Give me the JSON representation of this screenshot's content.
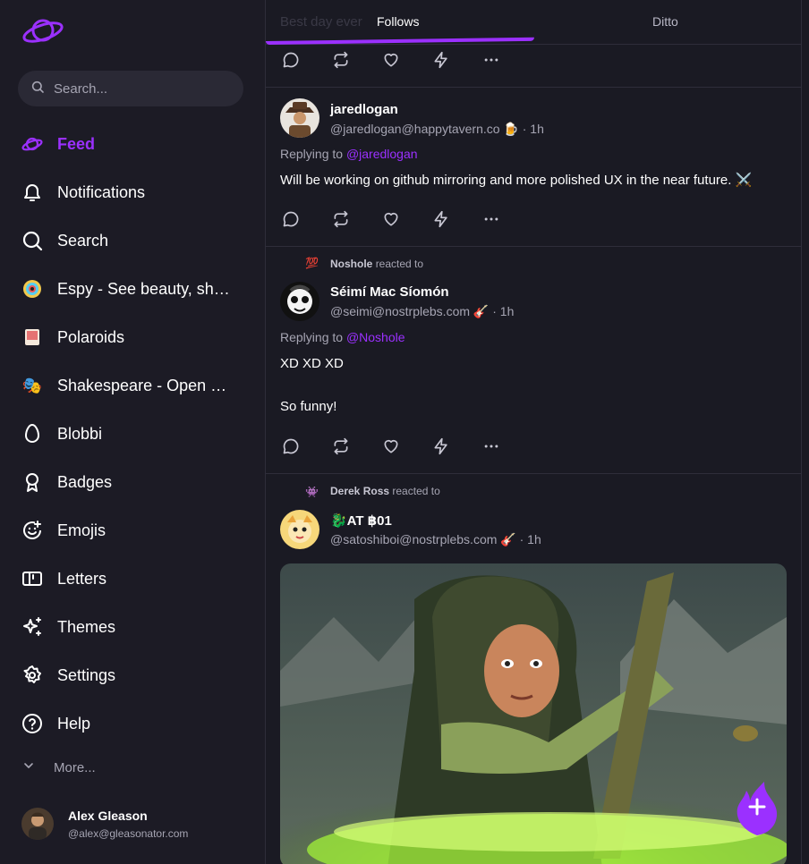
{
  "sidebar": {
    "search_placeholder": "Search...",
    "items": [
      {
        "label": "Feed",
        "icon": "planet-icon",
        "active": true
      },
      {
        "label": "Notifications",
        "icon": "bell-icon"
      },
      {
        "label": "Search",
        "icon": "search-icon"
      },
      {
        "label": "Espy - See beauty, sh…",
        "icon": "espy-app-icon"
      },
      {
        "label": "Polaroids",
        "icon": "polaroids-app-icon"
      },
      {
        "label": "Shakespeare - Open …",
        "icon": "shakespeare-app-icon"
      },
      {
        "label": "Blobbi",
        "icon": "egg-icon"
      },
      {
        "label": "Badges",
        "icon": "badge-icon"
      },
      {
        "label": "Emojis",
        "icon": "smile-icon"
      },
      {
        "label": "Letters",
        "icon": "letters-icon"
      },
      {
        "label": "Themes",
        "icon": "sparkles-icon"
      },
      {
        "label": "Settings",
        "icon": "gear-icon"
      },
      {
        "label": "Help",
        "icon": "help-icon"
      }
    ],
    "more_label": "More...",
    "account": {
      "name": "Alex Gleason",
      "handle": "@alex@gleasonator.com"
    }
  },
  "feed": {
    "tabs": {
      "ghost_text": "Best day ever",
      "follows": "Follows",
      "ditto": "Ditto"
    },
    "posts": [
      {
        "name": "jaredlogan",
        "handle": "@jaredlogan@happytavern.co 🍺 · 1h",
        "replying_label": "Replying to ",
        "replying_to": "@jaredlogan",
        "content": "Will be working on github mirroring and more polished UX in the near future. ⚔️"
      },
      {
        "reacted_by": "Noshole",
        "reacted_text": "reacted to",
        "reaction_emoji": "💯",
        "name": "Séimí Mac Síomón",
        "handle": "@seimi@nostrplebs.com 🎸 · 1h",
        "replying_label": "Replying to ",
        "replying_to": "@Noshole",
        "content_line1": "XD XD XD",
        "content_line2": "So funny!"
      },
      {
        "reacted_by": "Derek Ross",
        "reacted_text": "reacted to",
        "reaction_emoji": "👾",
        "name": "🐉AT ฿01",
        "handle": "@satoshiboi@nostrplebs.com 🎸 · 1h"
      }
    ]
  },
  "colors": {
    "accent": "#9b30ff",
    "background": "#1a1a23",
    "sidebar": "#1c1b25",
    "muted": "#a6a5b3"
  }
}
